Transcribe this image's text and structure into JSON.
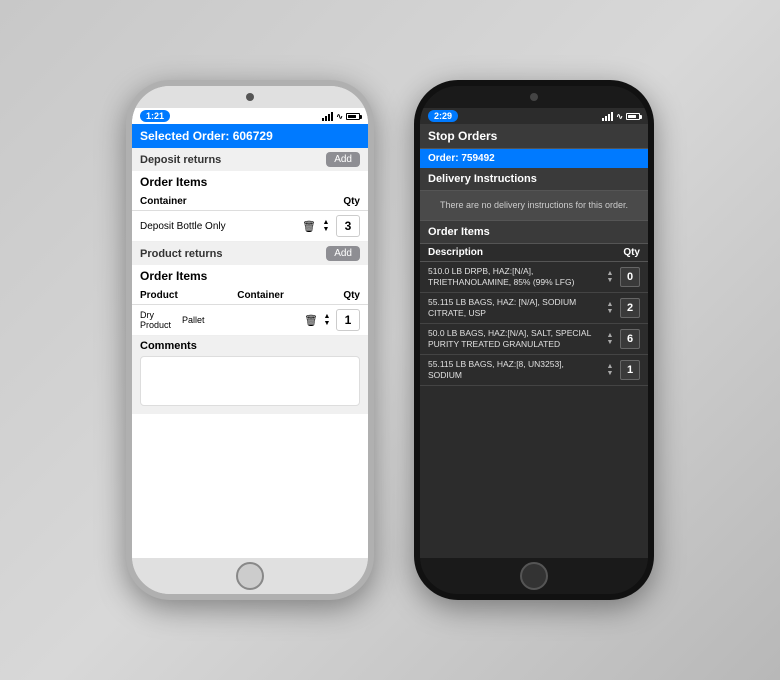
{
  "left_phone": {
    "time": "1:21",
    "selected_order_label": "Selected Order: 606729",
    "deposit_returns": {
      "section_label": "Deposit returns",
      "add_label": "Add",
      "order_items_title": "Order Items",
      "table_headers": [
        "Container",
        "Qty"
      ],
      "rows": [
        {
          "container": "Deposit Bottle Only",
          "qty": "3"
        }
      ]
    },
    "product_returns": {
      "section_label": "Product returns",
      "add_label": "Add",
      "order_items_title": "Order Items",
      "table_headers": [
        "Product",
        "Container",
        "Qty"
      ],
      "rows": [
        {
          "product": "Dry Product",
          "container": "Pallet",
          "qty": "1"
        }
      ]
    },
    "comments": {
      "title": "Comments"
    }
  },
  "right_phone": {
    "time": "2:29",
    "stop_orders_title": "Stop Orders",
    "order_row": "Order: 759492",
    "delivery_instructions_title": "Delivery Instructions",
    "delivery_note": "There are no delivery instructions for this order.",
    "order_items_title": "Order Items",
    "table_headers": [
      "Description",
      "Qty"
    ],
    "rows": [
      {
        "description": "510.0 LB DRPB, HAZ:[N/A], TRIETHANOLAMINE, 85% (99% LFG)",
        "qty": "0"
      },
      {
        "description": "55.115 LB BAGS, HAZ: [N/A], SODIUM CITRATE, USP",
        "qty": "2"
      },
      {
        "description": "50.0 LB BAGS, HAZ:[N/A], SALT, SPECIAL PURITY TREATED GRANULATED",
        "qty": "6"
      },
      {
        "description": "55.115 LB BAGS, HAZ:[8, UN3253], SODIUM",
        "qty": "1"
      }
    ]
  },
  "icons": {
    "up_arrow": "▲",
    "down_arrow": "▼",
    "trash": "🗑"
  }
}
